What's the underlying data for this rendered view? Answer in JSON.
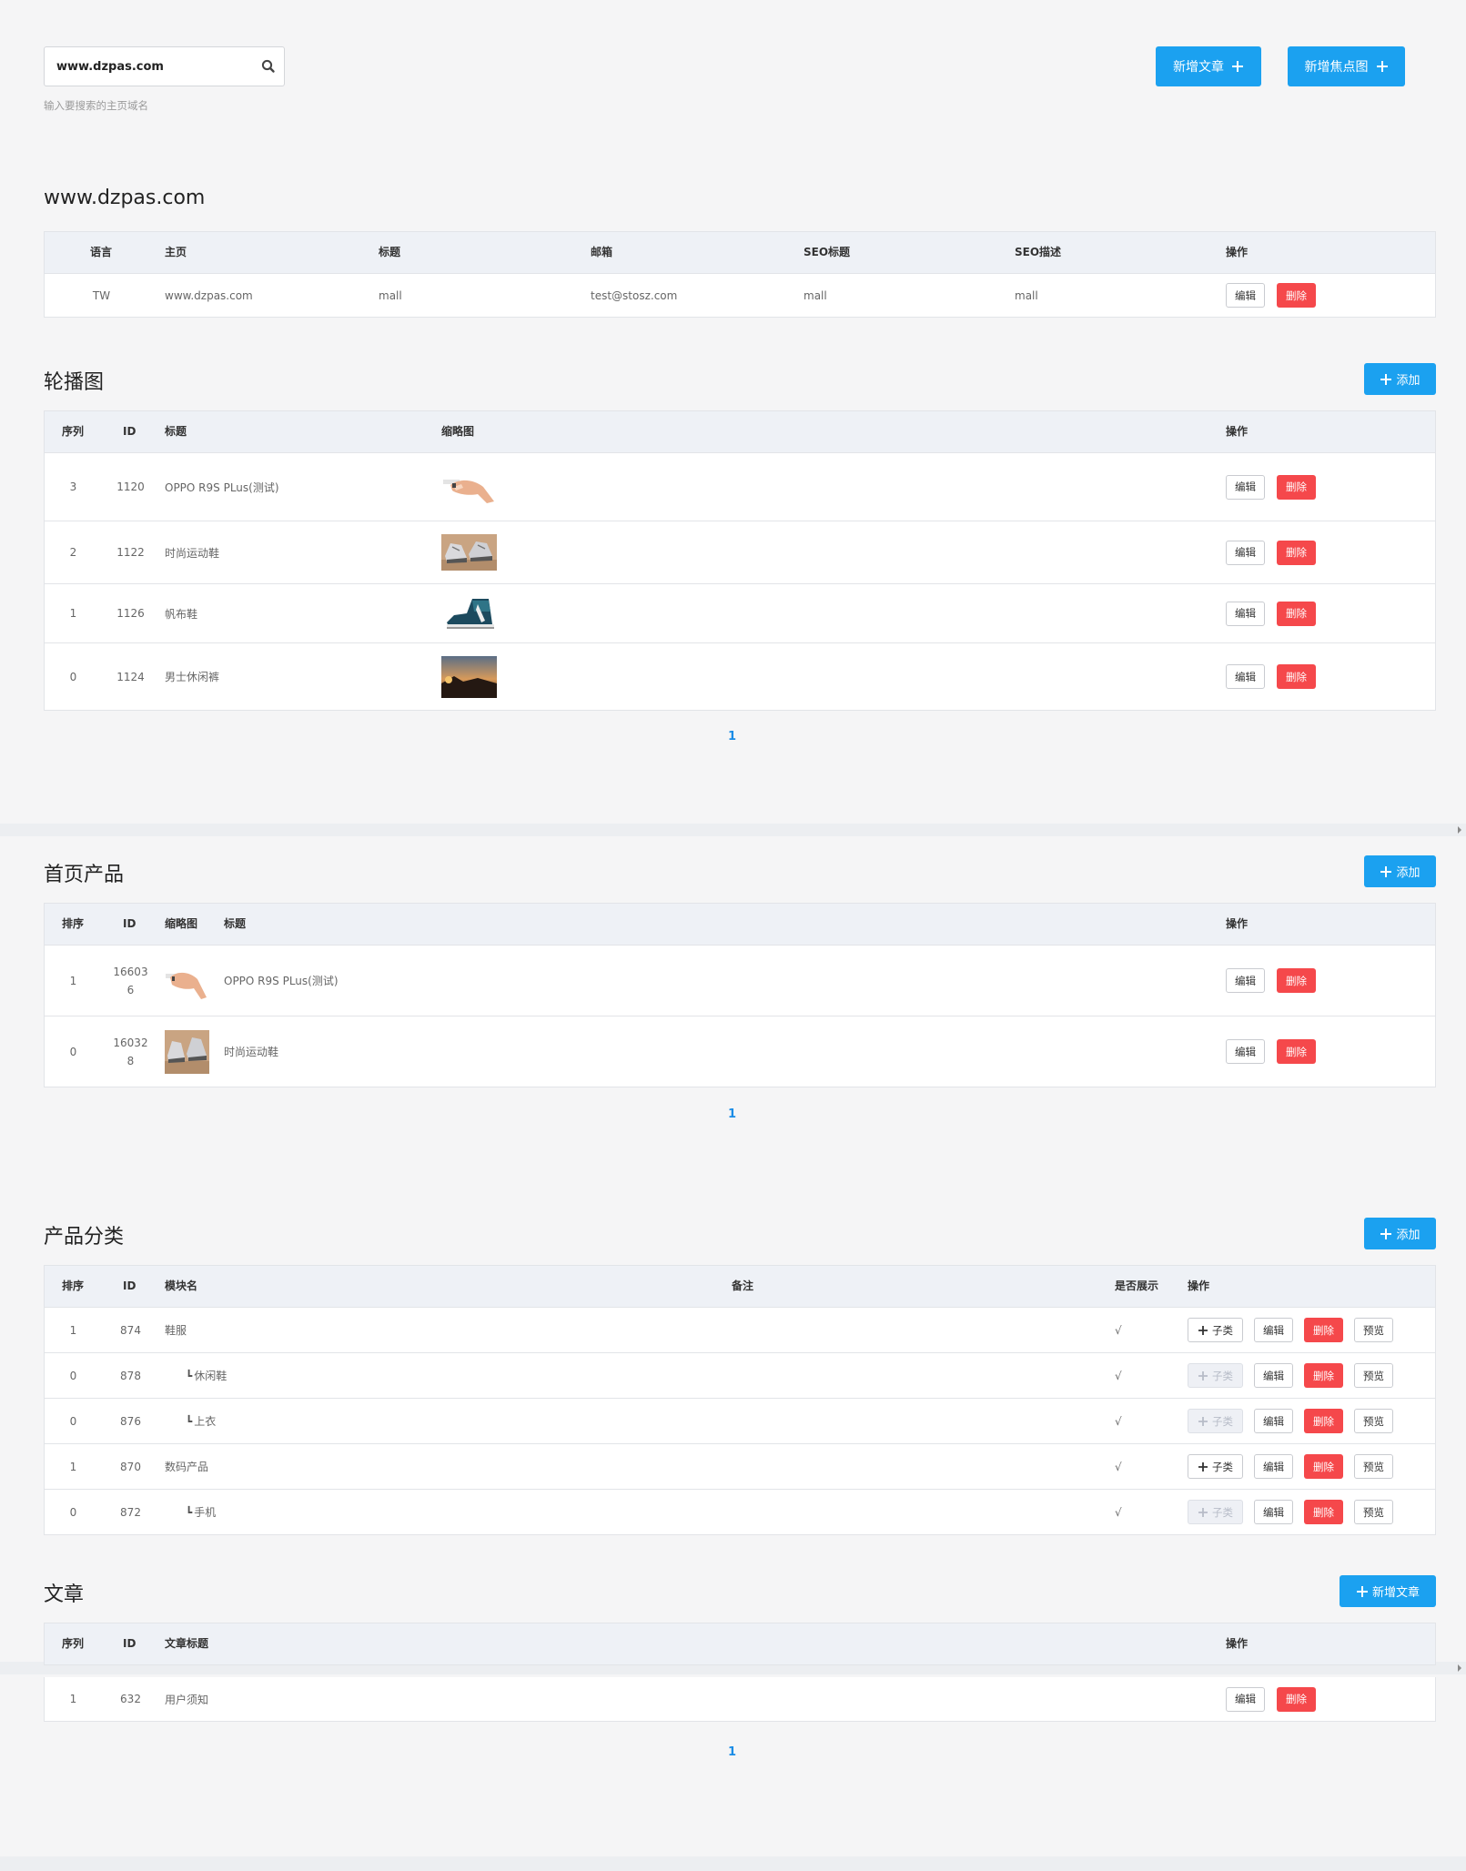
{
  "search": {
    "value": "www.dzpas.com",
    "hint": "输入要搜索的主页域名"
  },
  "top_buttons": {
    "new_article": "新增文章",
    "new_focus": "新增焦点图"
  },
  "site": {
    "title": "www.dzpas.com",
    "headers": [
      "语言",
      "主页",
      "标题",
      "邮箱",
      "SEO标题",
      "SEO描述",
      "操作"
    ],
    "row": {
      "lang": "TW",
      "home": "www.dzpas.com",
      "title": "mall",
      "email": "test@stosz.com",
      "seo_title": "mall",
      "seo_desc": "mall"
    }
  },
  "carousel": {
    "title": "轮播图",
    "add": "添加",
    "headers": [
      "序列",
      "ID",
      "标题",
      "缩略图",
      "操作"
    ],
    "rows": [
      {
        "order": "3",
        "id": "1120",
        "title": "OPPO R9S PLus(测试)",
        "thumb": "hand-image"
      },
      {
        "order": "2",
        "id": "1122",
        "title": "时尚运动鞋",
        "thumb": "sneaker-image"
      },
      {
        "order": "1",
        "id": "1126",
        "title": "帆布鞋",
        "thumb": "canvas-shoe-image"
      },
      {
        "order": "0",
        "id": "1124",
        "title": "男士休闲裤",
        "thumb": "sunset-image"
      }
    ],
    "page": "1"
  },
  "home_products": {
    "title": "首页产品",
    "add": "添加",
    "headers": [
      "排序",
      "ID",
      "缩略图",
      "标题",
      "操作"
    ],
    "rows": [
      {
        "order": "1",
        "id_line1": "16603",
        "id_line2": "6",
        "title": "OPPO R9S PLus(测试)",
        "thumb": "hand-image"
      },
      {
        "order": "0",
        "id_line1": "16032",
        "id_line2": "8",
        "title": "时尚运动鞋",
        "thumb": "sneaker-image"
      }
    ],
    "page": "1"
  },
  "categories": {
    "title": "产品分类",
    "add": "添加",
    "headers": [
      "排序",
      "ID",
      "模块名",
      "备注",
      "是否展示",
      "操作"
    ],
    "rows": [
      {
        "order": "1",
        "id": "874",
        "name": "鞋服",
        "child": false,
        "show": "√",
        "sub_enabled": true
      },
      {
        "order": "0",
        "id": "878",
        "name": "休闲鞋",
        "child": true,
        "show": "√",
        "sub_enabled": false
      },
      {
        "order": "0",
        "id": "876",
        "name": "上衣",
        "child": true,
        "show": "√",
        "sub_enabled": false
      },
      {
        "order": "1",
        "id": "870",
        "name": "数码产品",
        "child": false,
        "show": "√",
        "sub_enabled": true
      },
      {
        "order": "0",
        "id": "872",
        "name": "手机",
        "child": true,
        "show": "√",
        "sub_enabled": false
      }
    ],
    "child_prefix": "┗",
    "sub_label": "子类",
    "preview": "预览"
  },
  "articles": {
    "title": "文章",
    "add": "新增文章",
    "headers": [
      "序列",
      "ID",
      "文章标题",
      "操作"
    ],
    "rows": [
      {
        "order": "1",
        "id": "632",
        "title": "用户须知"
      }
    ],
    "page": "1"
  },
  "actions": {
    "edit": "编辑",
    "delete": "删除"
  },
  "colors": {
    "primary": "#1ba1f0",
    "danger": "#f5484b",
    "link": "#1a8ce6",
    "header_bg": "#eef1f6",
    "page_bg": "#f5f5f6"
  }
}
